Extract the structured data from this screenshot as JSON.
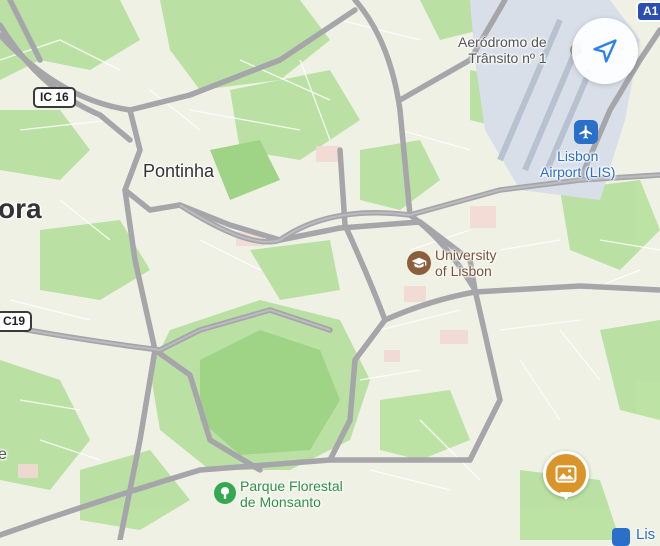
{
  "map": {
    "places": {
      "aerodromo_line1": "Aeródromo de",
      "aerodromo_line2": "Trânsito nº 1",
      "airport_line1": "Lisbon",
      "airport_line2": "Airport (LIS)",
      "pontinha": "Pontinha",
      "amadora_partial": "ora",
      "university_line1": "University",
      "university_line2": "of Lisbon",
      "park_line1": "Parque Florestal",
      "park_line2": "de Monsanto",
      "edge_e": "e",
      "edge_lis": "Lis"
    },
    "route_shields": {
      "ic16": "IC 16",
      "ic19": "C19",
      "a1": "A1"
    },
    "icons": {
      "locate": "location-arrow-icon",
      "airport": "airplane-icon",
      "university": "graduation-cap-icon",
      "park": "tree-icon",
      "photo": "photo-icon"
    },
    "colors": {
      "land": "#eef1e4",
      "green": "#b5df9c",
      "roads": "#a6a6aa",
      "airport_area": "#d9dfe9",
      "label_airport": "#2a6fc9",
      "label_university": "#7a5537",
      "label_park": "#2f8f43",
      "accent_locate": "#2f7ef0",
      "photo_pin": "#d9942a"
    }
  }
}
